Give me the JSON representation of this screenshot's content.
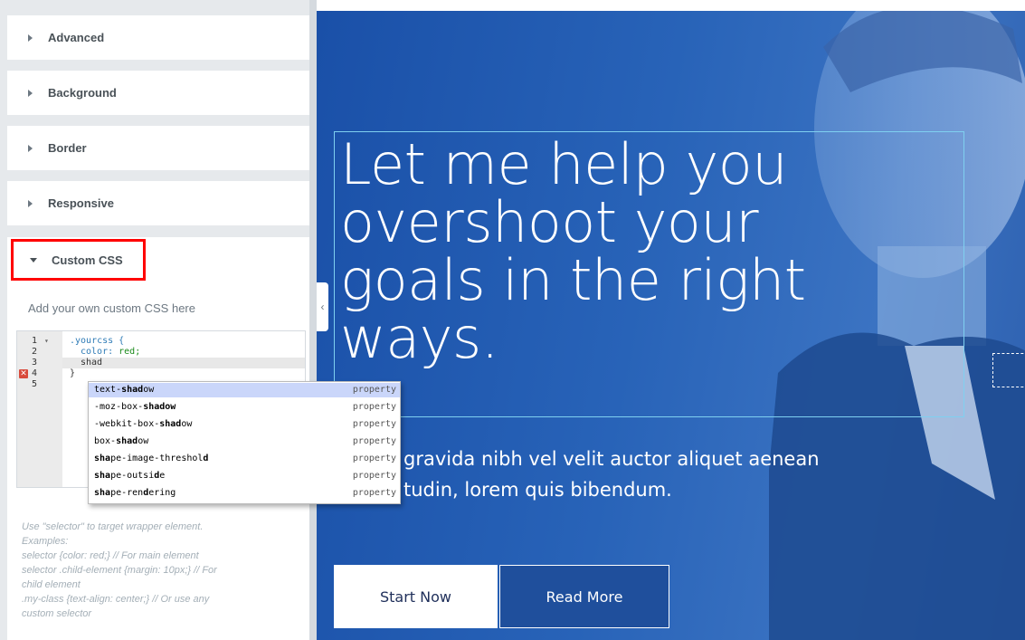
{
  "panel": {
    "sections": [
      {
        "label": "Advanced"
      },
      {
        "label": "Background"
      },
      {
        "label": "Border"
      },
      {
        "label": "Responsive"
      }
    ],
    "custom_css": {
      "label": "Custom CSS",
      "description": "Add your own custom CSS here",
      "editor": {
        "line_numbers": [
          "1",
          "2",
          "3",
          "4",
          "5"
        ],
        "line1": ".yourcss {",
        "line2_prop": "color:",
        "line2_val": " red;",
        "line3": "shad",
        "line4": "}",
        "error_mark": "✕"
      },
      "autocomplete": [
        {
          "pre": "text-",
          "match": "shad",
          "post": "ow",
          "meta": "property"
        },
        {
          "pre": "-moz-box-",
          "match": "shadow",
          "post": "",
          "meta": "property"
        },
        {
          "pre": "-webkit-box-",
          "match": "shad",
          "post": "ow",
          "meta": "property"
        },
        {
          "pre": "box-",
          "match": "shad",
          "post": "ow",
          "meta": "property"
        },
        {
          "pre": "",
          "match": "sha",
          "post": "pe-image-threshol",
          "tail": "d",
          "meta": "property"
        },
        {
          "pre": "",
          "match": "sha",
          "post": "pe-outsi",
          "tail": "d",
          "tail2": "e",
          "meta": "property"
        },
        {
          "pre": "",
          "match": "sha",
          "post": "pe-ren",
          "tail": "d",
          "tail2": "ering",
          "meta": "property"
        }
      ],
      "help": [
        "Use \"selector\" to target wrapper element.",
        "Examples:",
        "selector {color: red;} // For main element",
        "selector .child-element {margin: 10px;} // For",
        "child element",
        ".my-class {text-align: center;} // Or use any",
        "custom selector"
      ]
    }
  },
  "preview": {
    "title": "Let me help you overshoot your goals in the right ways.",
    "title_lines": [
      "Let me help you",
      "overshoot your",
      "goals in the right",
      "ways."
    ],
    "text_lines": [
      "gravida nibh vel velit auctor aliquet aenean",
      "tudin, lorem quis bibendum."
    ],
    "buttons": {
      "start": "Start Now",
      "read": "Read More"
    }
  },
  "colors": {
    "highlight": "#ff0000",
    "hero_blue": "#2863b8",
    "autocomplete_selected": "#cad6fa"
  }
}
